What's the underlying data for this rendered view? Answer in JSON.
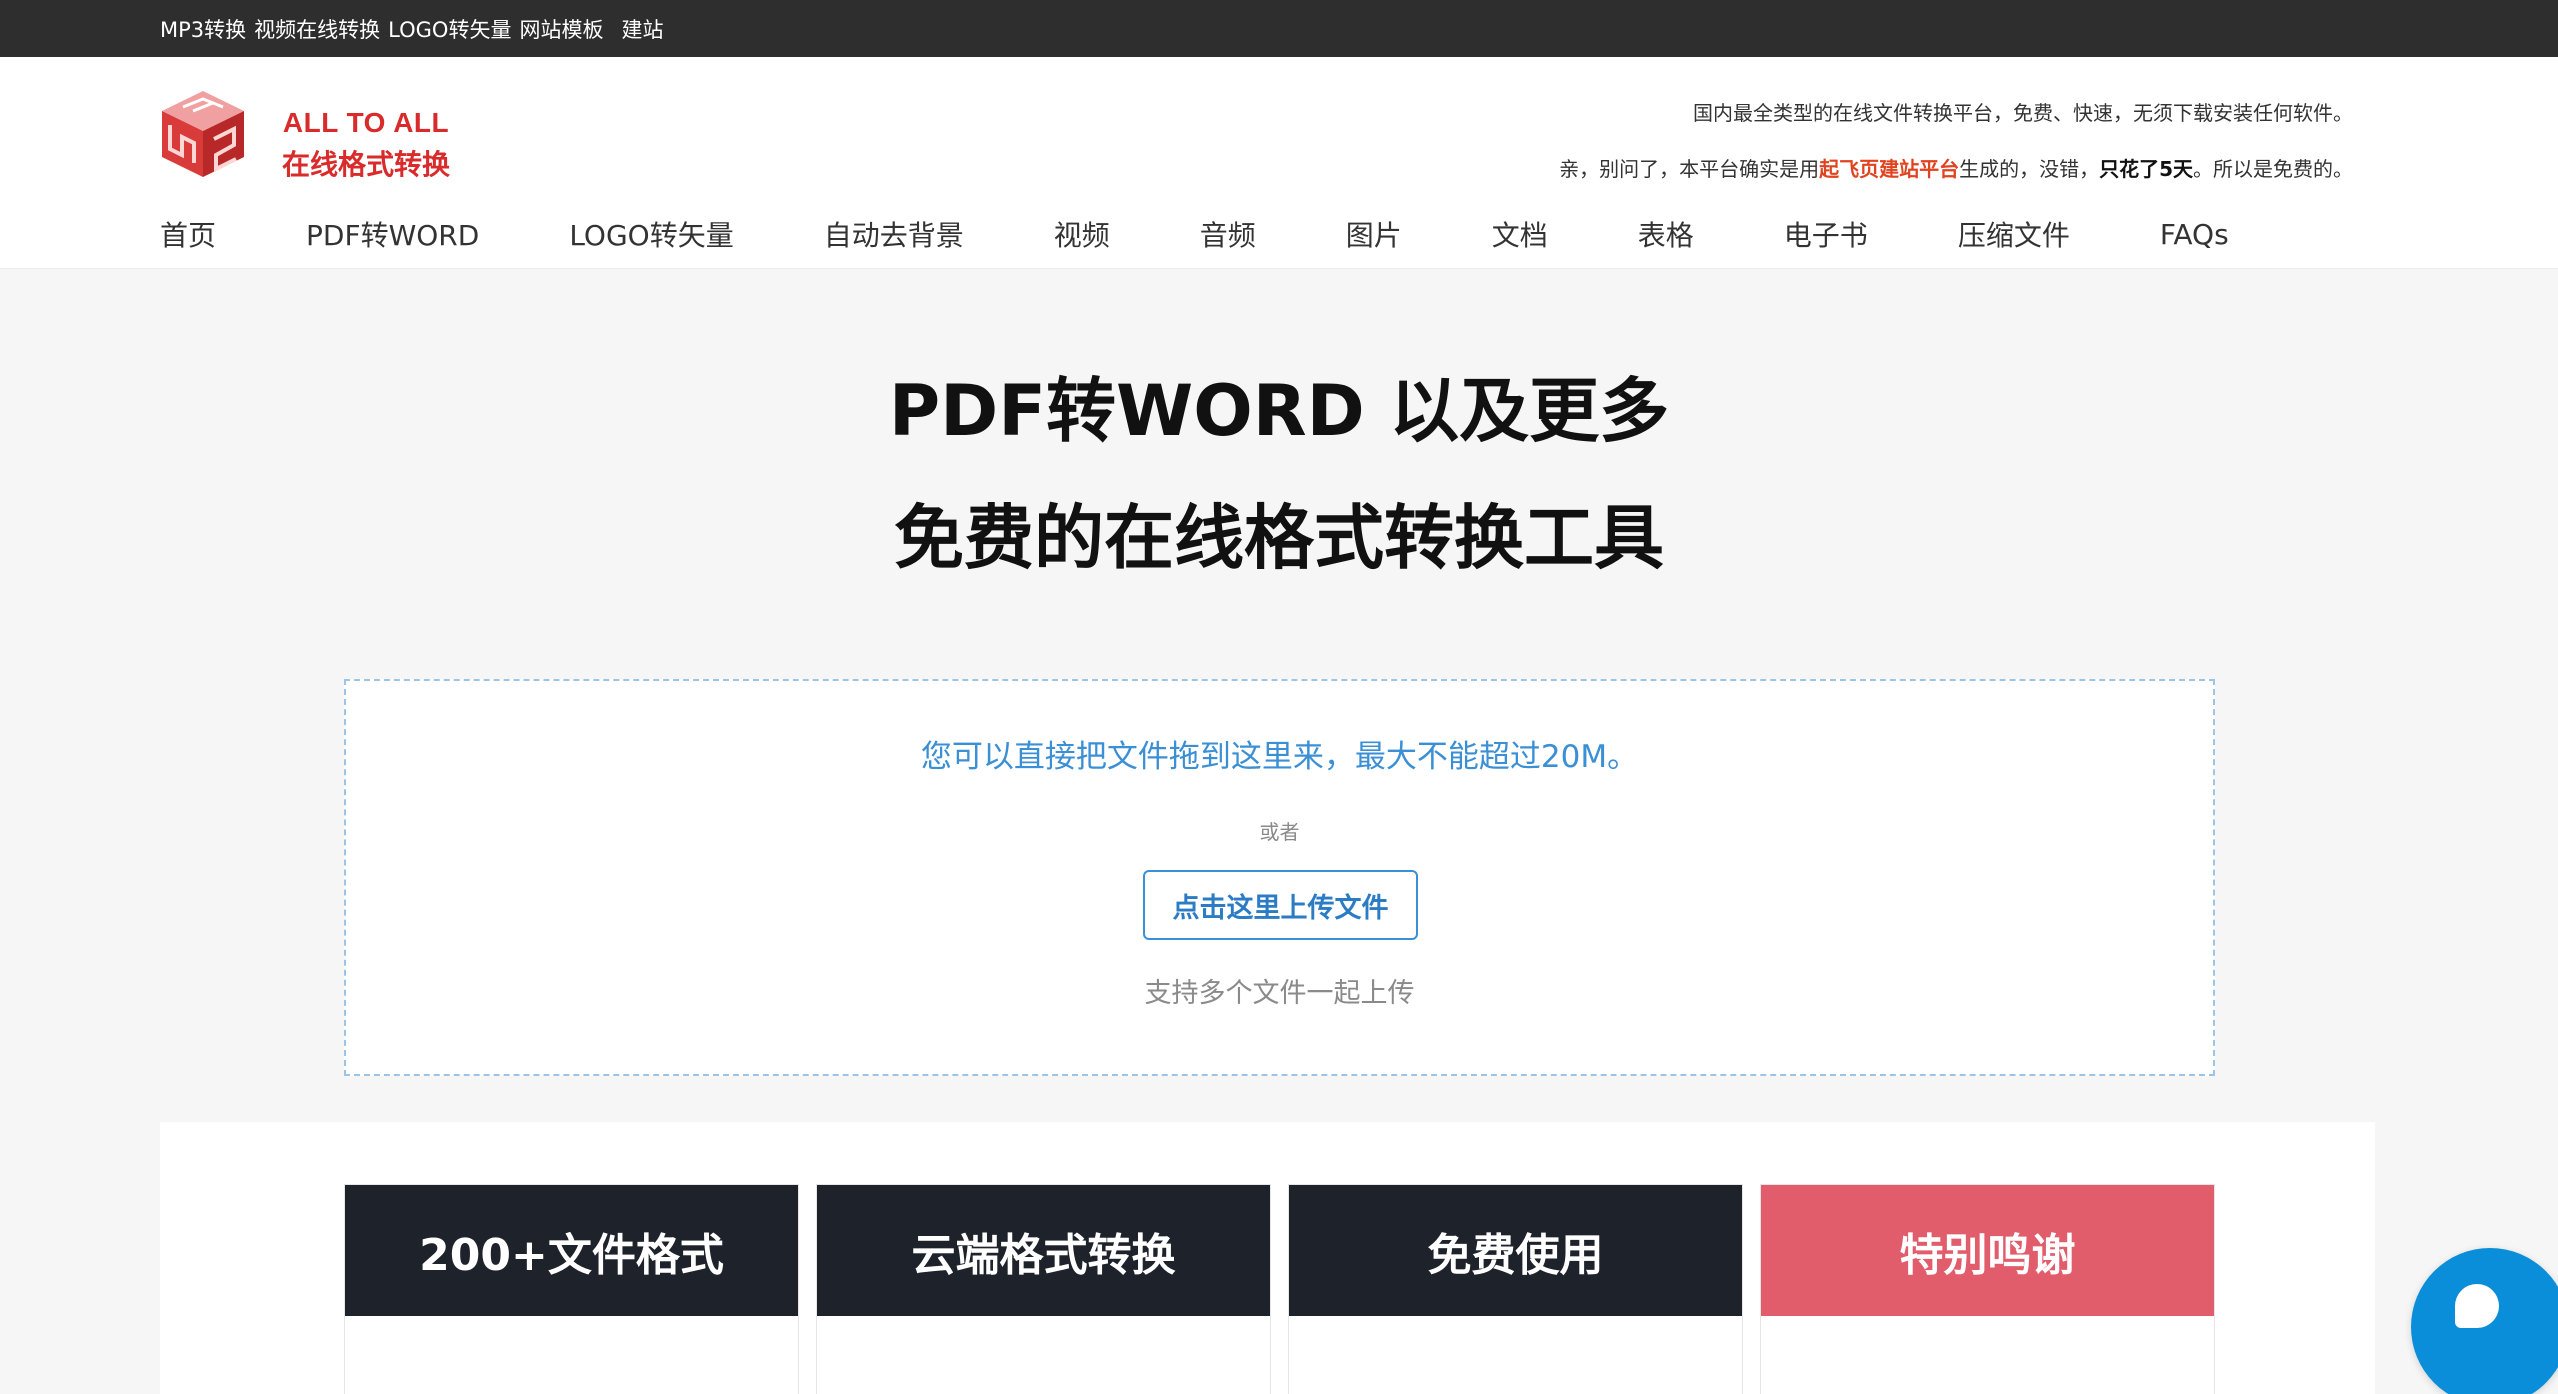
{
  "topbar": {
    "links": [
      "MP3转换",
      "视频在线转换",
      "LOGO转矢量",
      "网站模板",
      "建站"
    ]
  },
  "header": {
    "logo_en": "ALL TO ALL",
    "logo_cn": "在线格式转换",
    "tagline1": "国内最全类型的在线文件转换平台，免费、快速，无须下载安装任何软件。",
    "tagline2_a": "亲，别问了，本平台确实是用",
    "tagline2_link": "起飞页建站平台",
    "tagline2_b": "生成的，没错，",
    "tagline2_bold": "只花了5天",
    "tagline2_c": "。所以是免费的。"
  },
  "nav": {
    "items": [
      "首页",
      "PDF转WORD",
      "LOGO转矢量",
      "自动去背景",
      "视频",
      "音频",
      "图片",
      "文档",
      "表格",
      "电子书",
      "压缩文件",
      "FAQs"
    ]
  },
  "hero": {
    "title1": "PDF转WORD 以及更多",
    "title2": "免费的在线格式转换工具"
  },
  "dropzone": {
    "hint": "您可以直接把文件拖到这里来，最大不能超过20M。",
    "or": "或者",
    "upload_label": "点击这里上传文件",
    "multi": "支持多个文件一起上传"
  },
  "features": {
    "cards": [
      "200+文件格式",
      "云端格式转换",
      "免费使用",
      "特别鸣谢"
    ]
  },
  "colors": {
    "topbar": "#2e2e2e",
    "brand_red": "#d92b2b",
    "link_blue": "#3b8fd4",
    "card_dark": "#1e222b",
    "card_pink": "#e25d6c",
    "chat_blue": "#0a8ed9"
  }
}
